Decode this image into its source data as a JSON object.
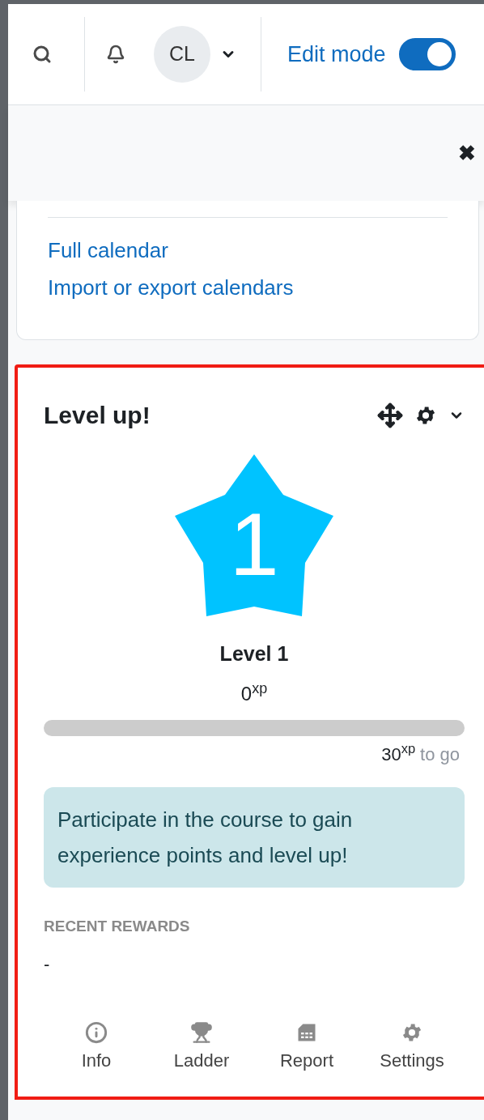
{
  "navbar": {
    "avatar_initials": "CL",
    "edit_mode": {
      "label": "Edit mode",
      "on": true
    }
  },
  "drawer": {
    "close": "✖"
  },
  "calendar_card": {
    "links": [
      "Full calendar",
      "Import or export calendars"
    ]
  },
  "block": {
    "title": "Level up!",
    "level_number": "1",
    "level_label": "Level 1",
    "xp": "0$^{xp}$",
    "progress": {
      "level": 0
    },
    "to_go_points": "30$^{xp}$",
    "to_go_suffix": "to go",
    "message": "Participate in the course to gain experience points and level up!",
    "rewards_heading": "RECENT REWARDS",
    "rewards_value": "-",
    "footer_links": [
      {
        "kind": "info",
        "label": "Info"
      },
      {
        "kind": "ladder",
        "label": "Ladder"
      },
      {
        "kind": "report",
        "label": "Report"
      },
      {
        "kind": "settings",
        "label": "Settings"
      }
    ]
  }
}
